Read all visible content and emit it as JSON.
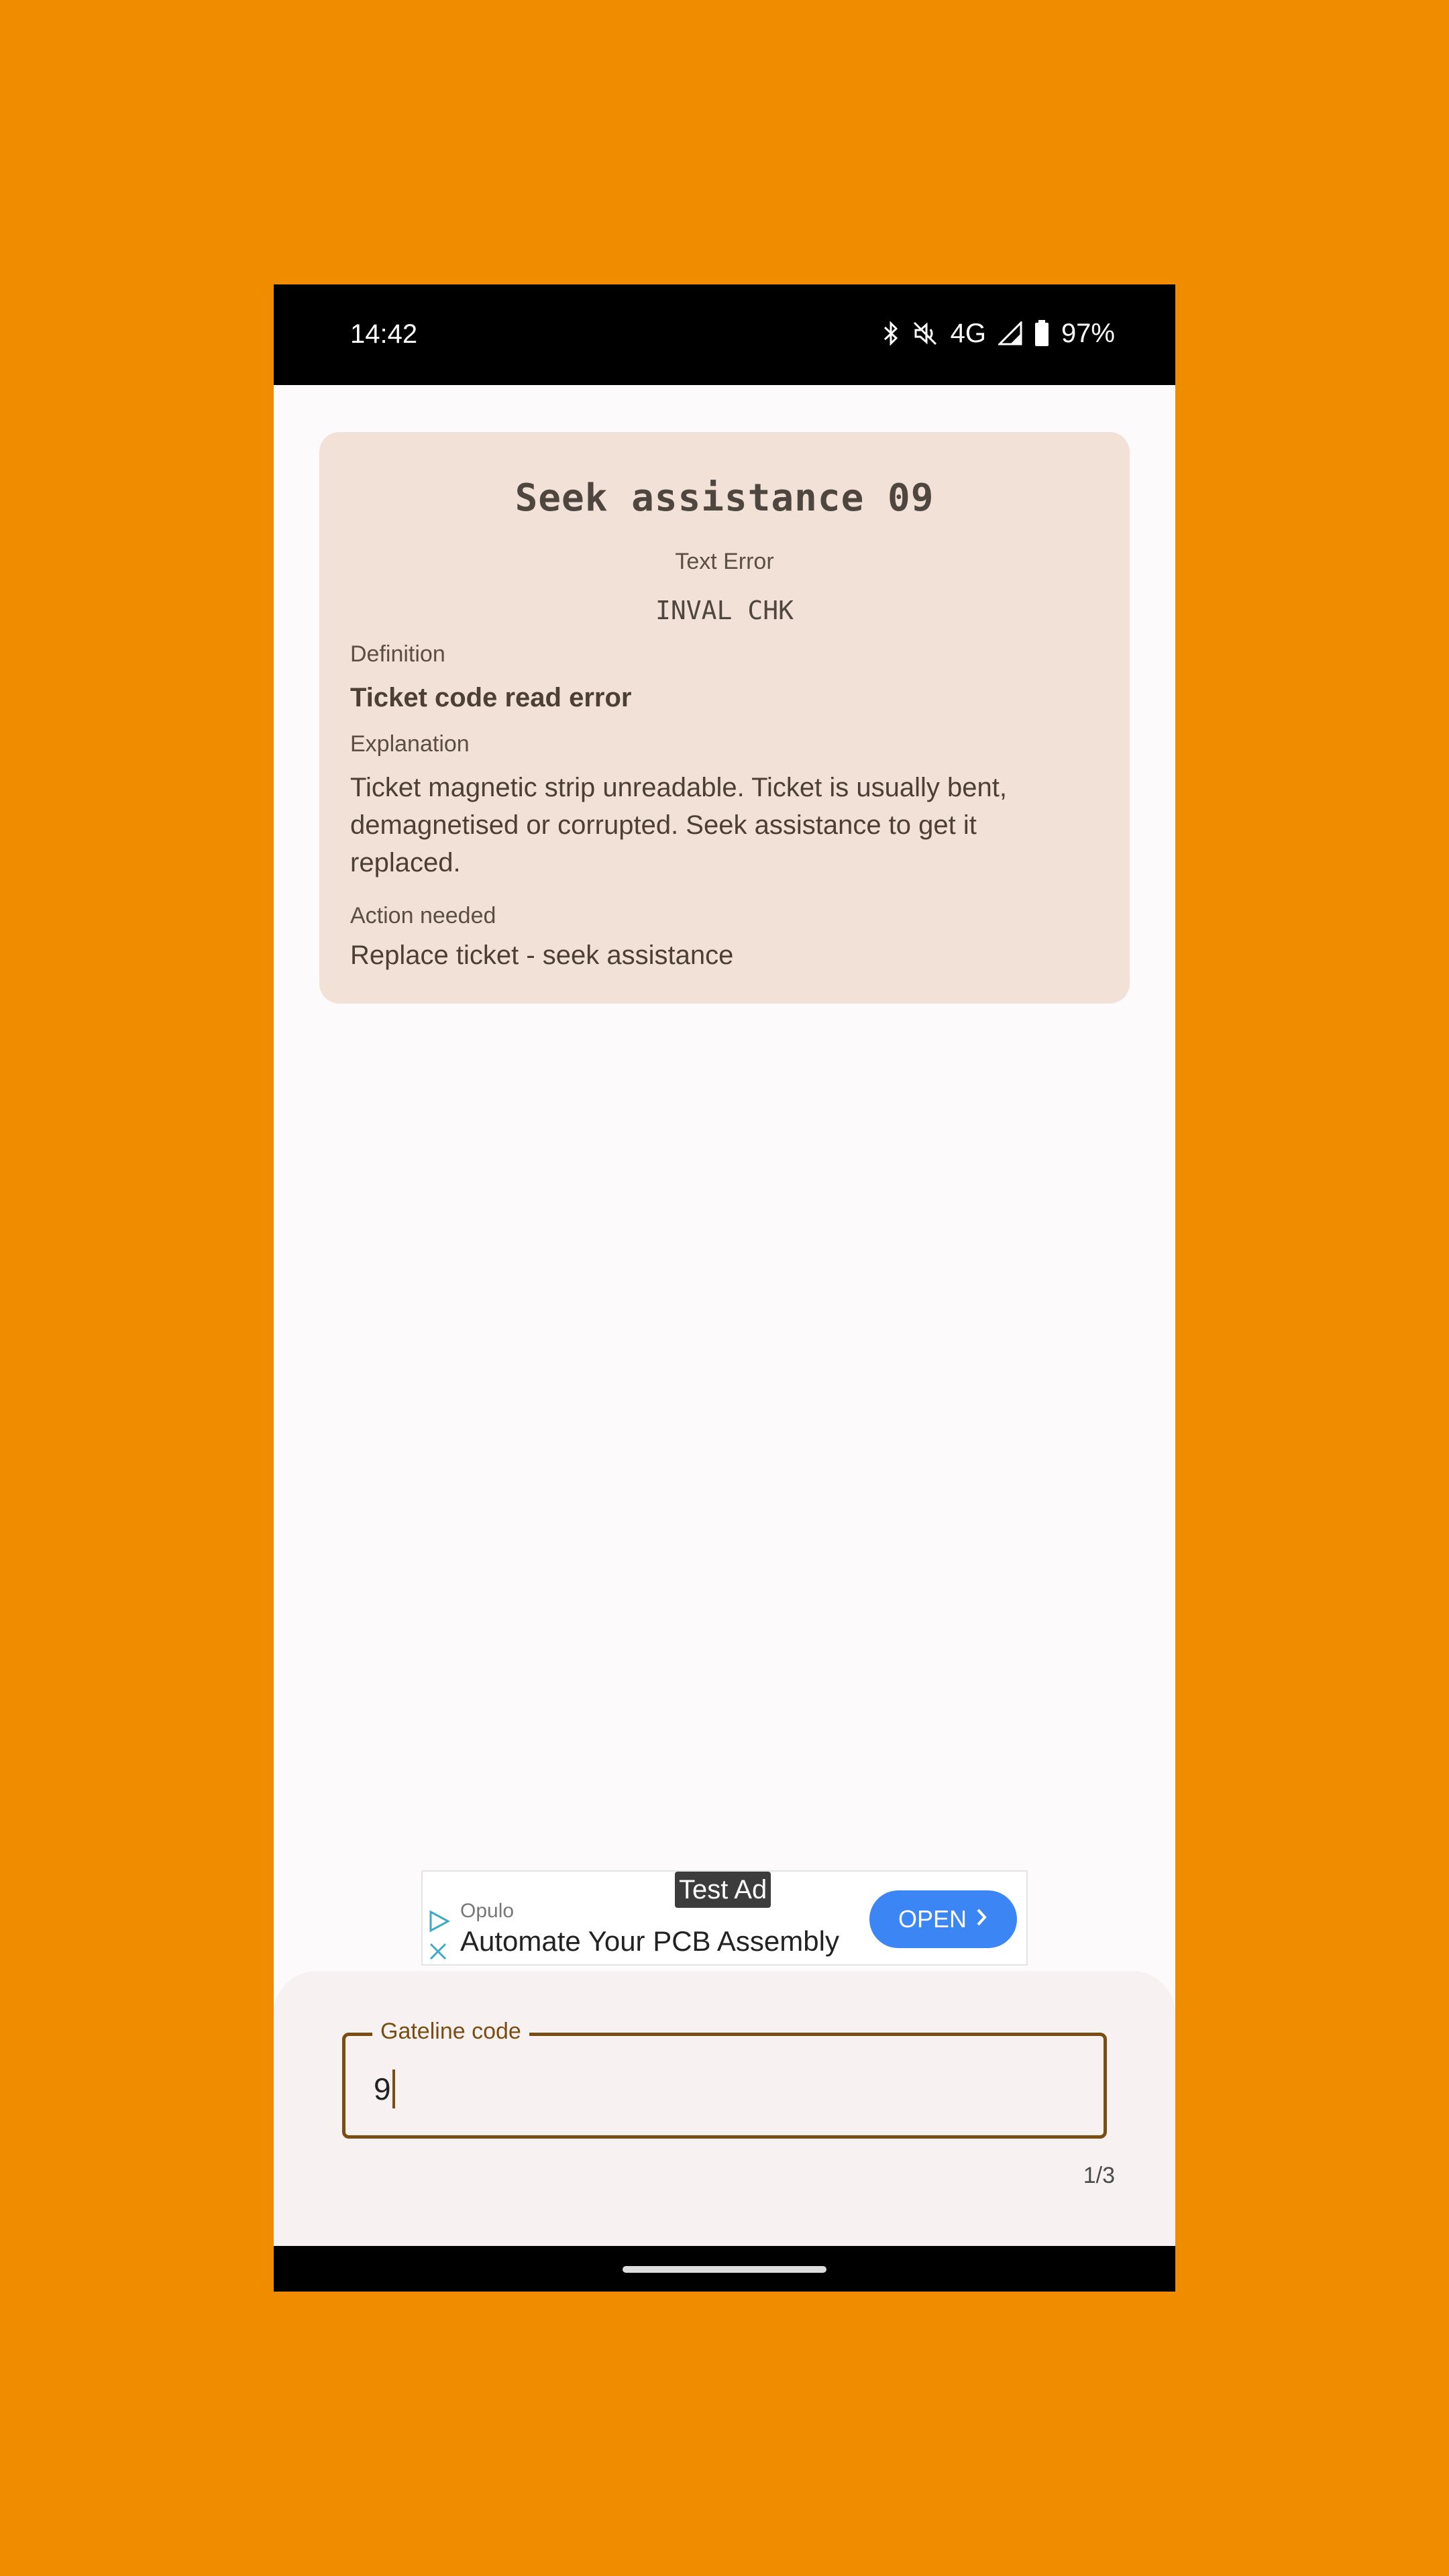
{
  "status_bar": {
    "time": "14:42",
    "network": "4G",
    "battery": "97%",
    "icons": [
      "bluetooth-icon",
      "mute-icon",
      "signal-icon",
      "battery-icon"
    ]
  },
  "card": {
    "title": "Seek assistance 09",
    "subtitle": "Text Error",
    "code": "INVAL CHK",
    "definition_label": "Definition",
    "definition": "Ticket code read error",
    "explanation_label": "Explanation",
    "explanation": "Ticket magnetic strip unreadable. Ticket is usually bent, demagnetised or corrupted. Seek assistance to get it replaced.",
    "action_label": "Action needed",
    "action": "Replace ticket - seek assistance"
  },
  "ad": {
    "badge": "Test Ad",
    "advertiser": "Opulo",
    "headline": "Automate Your PCB Assembly",
    "button": "OPEN"
  },
  "input": {
    "label": "Gateline code",
    "value": "9",
    "counter": "1/3"
  },
  "colors": {
    "background": "#EF8C00",
    "card": "#F1E1D6",
    "accent": "#7A4E13",
    "ad_button": "#3B86F4"
  }
}
